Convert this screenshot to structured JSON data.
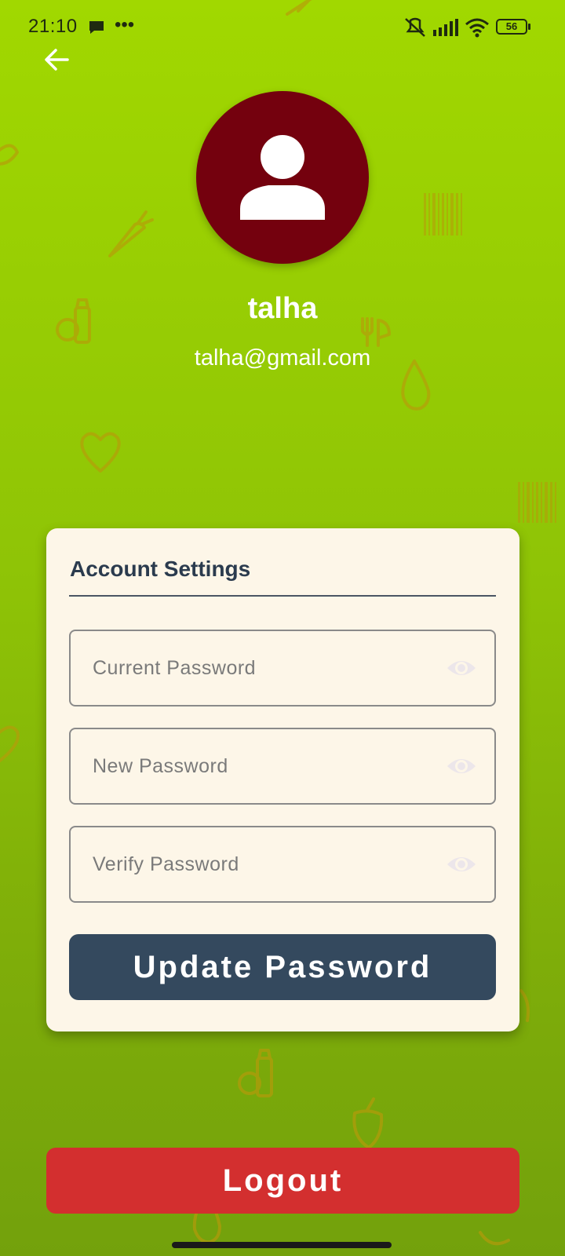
{
  "status_bar": {
    "time": "21:10",
    "dots": "•••",
    "battery": "56"
  },
  "profile": {
    "name": "talha",
    "email": "talha@gmail.com"
  },
  "account_settings": {
    "title": "Account Settings",
    "current_password_placeholder": "Current Password",
    "new_password_placeholder": "New Password",
    "verify_password_placeholder": "Verify Password",
    "update_button_label": "Update Password"
  },
  "logout_label": "Logout",
  "colors": {
    "background_top": "#a1d800",
    "background_bottom": "#73a10c",
    "avatar": "#74010e",
    "card": "#fdf6e8",
    "update_button": "#34495e",
    "logout_button": "#d32f2f",
    "decor": "#c9a300"
  }
}
